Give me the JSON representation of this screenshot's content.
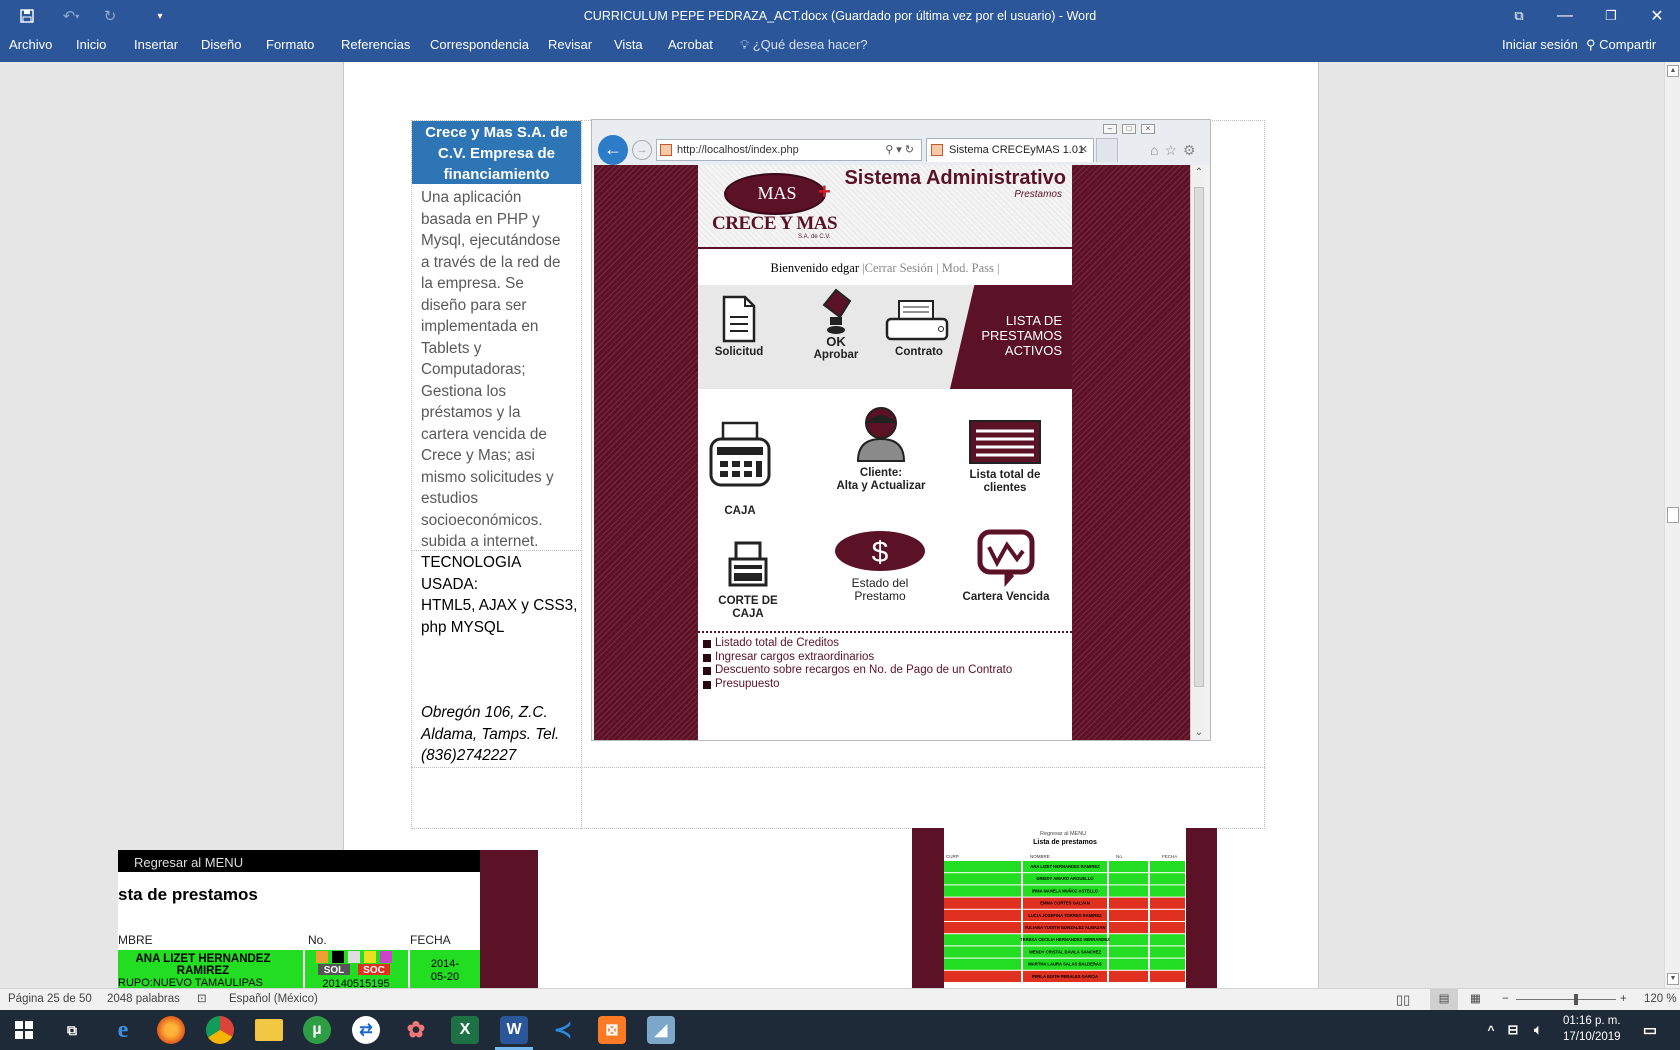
{
  "window": {
    "title": "CURRICULUM PEPE PEDRAZA_ACT.docx (Guardado por última vez por el usuario) - Word"
  },
  "ribbon": {
    "tabs": [
      "Archivo",
      "Inicio",
      "Insertar",
      "Diseño",
      "Formato",
      "Referencias",
      "Correspondencia",
      "Revisar",
      "Vista",
      "Acrobat"
    ],
    "tell_me": "¿Qué desea hacer?",
    "sign_in": "Iniciar sesión",
    "share": "Compartir"
  },
  "document": {
    "header_cell": "Crece y Mas S.A. de C.V. Empresa de financiamiento",
    "desc_lines": [
      "Una aplicación",
      "basada en PHP y",
      "Mysql, ejecutándose",
      "a través de la red de",
      "la empresa. Se",
      "diseño para ser",
      "implementada en",
      "Tablets y",
      "Computadoras;",
      "Gestiona los",
      "préstamos y la",
      "cartera vencida de",
      "Crece y Mas; asi",
      "mismo solicitudes y",
      "estudios",
      "socioeconómicos.",
      "subida a internet."
    ],
    "tech_lines": [
      "TECNOLOGIA",
      "USADA:",
      "HTML5, AJAX y CSS3,",
      "php MYSQL"
    ],
    "address_lines": [
      "Obregón 106, Z.C.",
      "Aldama, Tamps. Tel.",
      "(836)2742227"
    ]
  },
  "browser": {
    "url": "http://localhost/index.php",
    "tab_title": "Sistema CRECEyMAS 1.01",
    "app": {
      "logo_mas": "MAS",
      "logo_name": "CRECE Y MAS",
      "logo_sa": "S.A. de C.V.",
      "title": "Sistema Administrativo",
      "subtitle": "Prestamos",
      "welcome": "Bienvenido edgar",
      "logout": "|Cerrar Sesión | Mod. Pass |",
      "band_items": [
        "Solicitud",
        "Aprobar",
        "Contrato"
      ],
      "band_ok": "OK",
      "band_label": [
        "LISTA DE",
        "PRESTAMOS",
        "ACTIVOS"
      ],
      "grid": [
        {
          "label": "CAJA"
        },
        {
          "label": "Cliente:",
          "label2": "Alta y Actualizar"
        },
        {
          "label": "Lista total de",
          "label2": "clientes"
        },
        {
          "label": "CORTE DE CAJA"
        },
        {
          "label": "Estado del",
          "label2": "Prestamo"
        },
        {
          "label": "Cartera Vencida"
        }
      ],
      "links": [
        "Listado total de Creditos",
        "Ingresar cargos extraordinarios",
        "Descuento sobre recargos en No. de Pago de un Contrato",
        "Presupuesto"
      ]
    }
  },
  "shot_left": {
    "back": "Regresar al MENU",
    "title": "sta de prestamos",
    "headers": [
      "MBRE",
      "No.",
      "FECHA"
    ],
    "row_name": [
      "ANA LIZET HERNANDEZ",
      "RAMIREZ",
      "RUPO:NUEVO TAMAULIPAS"
    ],
    "row_no": "20140515195",
    "row_date": [
      "2014-",
      "05-20"
    ],
    "chips": [
      "SOL",
      "SOC"
    ]
  },
  "shot_right": {
    "back": "Regresar al MENU",
    "title": "Lista de prestamos",
    "headers": [
      "CURP",
      "NOMBRE",
      "No.",
      "FECHA"
    ],
    "rows": [
      {
        "name": "ANA LIZET HERNANDEZ RAMIREZ",
        "status": "green"
      },
      {
        "name": "DREIDY AMARO ARGUELLO",
        "status": "green"
      },
      {
        "name": "IRMA NAHELA MUÑOZ ASTELLO",
        "status": "green"
      },
      {
        "name": "EMMA CORTES GALVAN",
        "status": "red"
      },
      {
        "name": "LUCIA JOSEFINA TORRES RAMIREZ",
        "status": "red"
      },
      {
        "name": "YULIANA YUDITH GONZALEZ ALMAZAN",
        "status": "red"
      },
      {
        "name": "TERESA CECILIA HERNANDEZ HERNANDEZ",
        "status": "green"
      },
      {
        "name": "WENDY CRISTAL DAVILA SANCHEZ",
        "status": "green"
      },
      {
        "name": "MARTHA LAURA SALAS BALDERAS",
        "status": "green"
      },
      {
        "name": "PERLA EDITH PERALES GARCIA",
        "status": "red"
      }
    ]
  },
  "statusbar": {
    "page": "Página 25 de 50",
    "words": "2048 palabras",
    "language": "Español (México)",
    "zoom": "120 %",
    "zoom_level": 0.6
  },
  "taskbar": {
    "time": "01:16 p. m.",
    "date": "17/10/2019"
  },
  "colors": {
    "word_blue": "#2b579a",
    "header_cell": "#2e75b6",
    "brand_maroon": "#5b1126",
    "ok_green": "#22dd22",
    "alert_red": "#e03020"
  }
}
